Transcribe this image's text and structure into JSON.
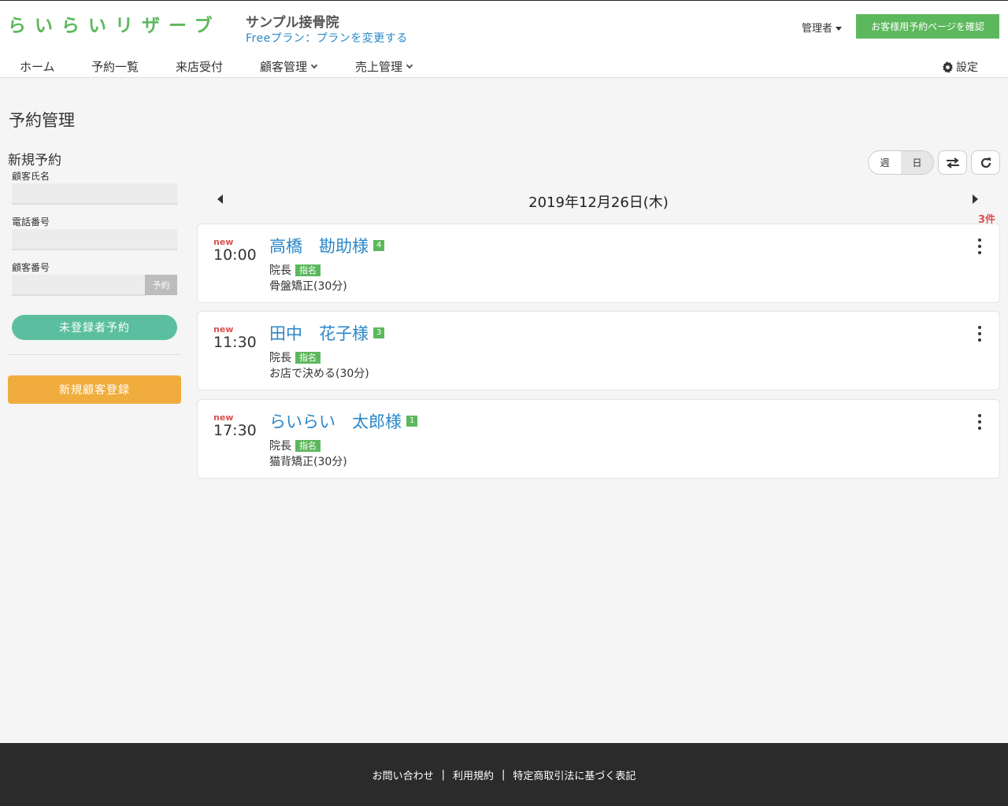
{
  "header": {
    "logo": "らいらいリザーブ",
    "shop_name": "サンプル接骨院",
    "plan_link": "Freeプラン：プランを変更する",
    "admin_menu": "管理者",
    "customer_page_button": "お客様用予約ページを確認"
  },
  "nav": {
    "home": "ホーム",
    "reservations": "予約一覧",
    "reception": "来店受付",
    "customers": "顧客管理",
    "sales": "売上管理",
    "settings": "設定"
  },
  "sidebar": {
    "page_title": "予約管理",
    "section_title": "新規予約",
    "customer_name_label": "顧客氏名",
    "customer_name_value": "",
    "phone_label": "電話番号",
    "phone_value": "",
    "customer_number_label": "顧客番号",
    "customer_number_value": "",
    "reserve_mini_button": "予約",
    "unregistered_button": "未登録者予約",
    "new_customer_button": "新規顧客登録"
  },
  "toolbar": {
    "view_week": "週",
    "view_day": "日",
    "active_view": "日"
  },
  "schedule": {
    "date": "2019年12月26日(木)",
    "count": "3件",
    "appointments": [
      {
        "badge": "new",
        "time": "10:00",
        "name": "高橋　勘助様",
        "visits": "4",
        "staff": "院長",
        "tag": "指名",
        "menu": "骨盤矯正(30分)"
      },
      {
        "badge": "new",
        "time": "11:30",
        "name": "田中　花子様",
        "visits": "3",
        "staff": "院長",
        "tag": "指名",
        "menu": "お店で決める(30分)"
      },
      {
        "badge": "new",
        "time": "17:30",
        "name": "らいらい　太郎様",
        "visits": "1",
        "staff": "院長",
        "tag": "指名",
        "menu": "猫背矯正(30分)"
      }
    ]
  },
  "footer": {
    "contact": "お問い合わせ",
    "terms": "利用規約",
    "commerce_law": "特定商取引法に基づく表記",
    "separator": "|"
  },
  "colors": {
    "brand_green": "#5cb85c",
    "link_blue": "#2a87c8",
    "teal_button": "#5bbf9f",
    "orange_button": "#f0ad3d",
    "alert_red": "#d9534f",
    "footer_bg": "#2b2b2b"
  },
  "icons": {
    "admin_caret": "caret-down-icon",
    "nav_chevron": "chevron-down-icon",
    "settings": "gear-icon",
    "swap": "swap-arrows-icon",
    "refresh": "refresh-icon",
    "prev_day": "triangle-left-icon",
    "next_day": "triangle-right-icon",
    "card_menu": "kebab-menu-icon"
  }
}
